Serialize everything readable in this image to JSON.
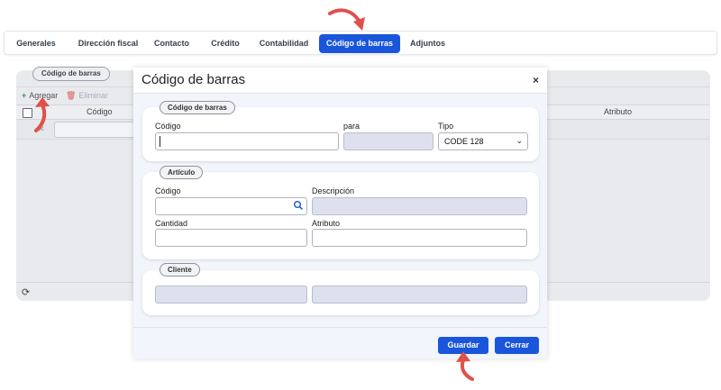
{
  "tabs": [
    {
      "label": "Generales"
    },
    {
      "label": "Dirección fiscal"
    },
    {
      "label": "Contacto"
    },
    {
      "label": "Crédito"
    },
    {
      "label": "Contabilidad"
    },
    {
      "label": "Código de barras",
      "active": true
    },
    {
      "label": "Adjuntos"
    }
  ],
  "background": {
    "legend": "Código de barras",
    "toolbar": {
      "add_label": "Agregar",
      "delete_label": "Eliminar"
    },
    "columns": {
      "codigo": "Código",
      "atributo": "Atributo"
    }
  },
  "modal": {
    "title": "Código de barras",
    "close_glyph": "×",
    "barcode_section": {
      "legend": "Código de barras",
      "codigo_label": "Código",
      "para_label": "para",
      "tipo_label": "Tipo",
      "tipo_value": "CODE 128"
    },
    "article_section": {
      "legend": "Artículo",
      "codigo_label": "Código",
      "descripcion_label": "Descripción",
      "cantidad_label": "Cantidad",
      "atributo_label": "Atributo"
    },
    "client_section": {
      "legend": "Cliente"
    },
    "buttons": {
      "save": "Guardar",
      "close": "Cerrar"
    }
  },
  "colors": {
    "accent": "#1a56db",
    "annotation_arrow": "#e0504a"
  },
  "icons": {
    "add": "plus-icon",
    "delete": "trash-icon",
    "refresh": "refresh-icon",
    "search": "search-icon",
    "close": "close-icon",
    "select": "chevron-down-icon"
  }
}
